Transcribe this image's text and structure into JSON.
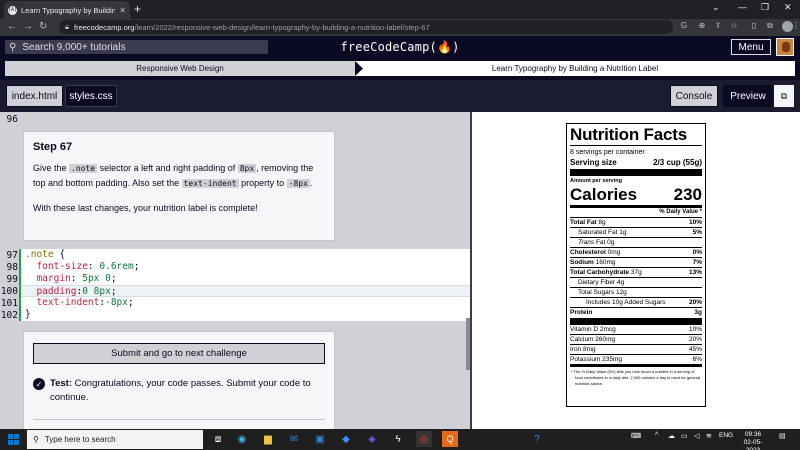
{
  "browser": {
    "tab_title": "Learn Typography by Building a N",
    "tab_close": "✕",
    "new_tab": "+",
    "url_host": "freecodecamp.org",
    "url_path": "/learn/2022/responsive-web-design/learn-typography-by-building-a-nutrition-label/step-67",
    "favicon_text": "(A)",
    "icons": [
      "back-icon",
      "forward-icon",
      "reload-icon",
      "lock-icon",
      "google-icon",
      "share-icon",
      "bookmark-icon",
      "extensions-icon",
      "sidepanel-icon",
      "profile-icon",
      "kebab-menu-icon"
    ]
  },
  "fcc": {
    "search_placeholder": "Search 9,000+ tutorials",
    "logo": "freeCodeCamp(🔥)",
    "menu_label": "Menu"
  },
  "breadcrumb": {
    "course": "Responsive Web Design",
    "project": "Learn Typography by Building a Nutrition Label"
  },
  "file_tabs": [
    "index.html",
    "styles.css"
  ],
  "toolbar": {
    "console": "Console",
    "preview": "Preview"
  },
  "editor": {
    "top_line": "96",
    "step_title": "Step 67",
    "instr_parts": [
      "Give the ",
      ".note",
      " selector a left and right padding of ",
      "8px",
      ", removing the top and bottom padding. Also set the ",
      "text-indent",
      " property to ",
      "-8px",
      "."
    ],
    "instr_final": "With these last changes, your nutrition label is complete!",
    "line_numbers": [
      "97",
      "98",
      "99",
      "100",
      "101",
      "102"
    ],
    "code": {
      "l1_sel": ".note",
      "l1_brace": " {",
      "l2_prop": "  font-size",
      "l2_val": "0.6rem",
      "l3_prop": "  margin",
      "l3_val": "5px 0",
      "l4_prop": "  padding",
      "l4_val": "0 8px",
      "l5_prop": "  text-indent",
      "l5_val": "-8px",
      "l6": "}"
    },
    "submit_label": "Submit and go to next challenge",
    "test_label": "Test:",
    "test_msg": "Congratulations, your code passes. Submit your code to continue."
  },
  "nutrition": {
    "title": "Nutrition Facts",
    "servings": "8 servings per container",
    "serving_size_label": "Serving size",
    "serving_size_val": "2/3 cup (55g)",
    "amount": "Amount per serving",
    "calories_label": "Calories",
    "calories_val": "230",
    "dv_header": "% Daily Value *",
    "rows": [
      {
        "label": "Total Fat",
        "bold": true,
        "amt": "8g",
        "dv": "10%",
        "cls": ""
      },
      {
        "label": "Saturated Fat",
        "bold": false,
        "amt": "1g",
        "dv": "5%",
        "cls": "ind"
      },
      {
        "label": "Trans",
        "bold": false,
        "amt": "Fat 0g",
        "dv": "",
        "cls": "ind",
        "italic": true
      },
      {
        "label": "Cholesterol",
        "bold": true,
        "amt": "0mg",
        "dv": "0%",
        "cls": ""
      },
      {
        "label": "Sodium",
        "bold": true,
        "amt": "160mg",
        "dv": "7%",
        "cls": ""
      },
      {
        "label": "Total Carbohydrate",
        "bold": true,
        "amt": "37g",
        "dv": "13%",
        "cls": ""
      },
      {
        "label": "Dietary Fiber",
        "bold": false,
        "amt": "4g",
        "dv": "",
        "cls": "ind"
      },
      {
        "label": "Total Sugars",
        "bold": false,
        "amt": "12g",
        "dv": "",
        "cls": "ind"
      },
      {
        "label": "Includes 10g Added Sugars",
        "bold": false,
        "amt": "",
        "dv": "20%",
        "cls": "ind2"
      },
      {
        "label": "Protein",
        "bold": true,
        "amt": "",
        "dv": "3g",
        "cls": ""
      }
    ],
    "vitamins": [
      {
        "label": "Vitamin D 2mcg",
        "dv": "10%"
      },
      {
        "label": "Calcium 260mg",
        "dv": "20%"
      },
      {
        "label": "Iron 8mg",
        "dv": "45%"
      },
      {
        "label": "Potassium 235mg",
        "dv": "6%"
      }
    ],
    "footnote": "* The % Daily Value (DV) tells you how much a nutrient in a serving of food contributes to a daily diet. 2,000 calories a day is used for general nutrition advice."
  },
  "taskbar": {
    "search_placeholder": "Type here to search",
    "lang": "ENG",
    "time": "09:36",
    "date": "02-05-2023",
    "apps": [
      "task-view-icon",
      "edge-icon",
      "explorer-icon",
      "mail-icon",
      "dropbox-icon",
      "app-icon",
      "terminal-icon",
      "chrome-icon",
      "orange-app-icon"
    ]
  }
}
